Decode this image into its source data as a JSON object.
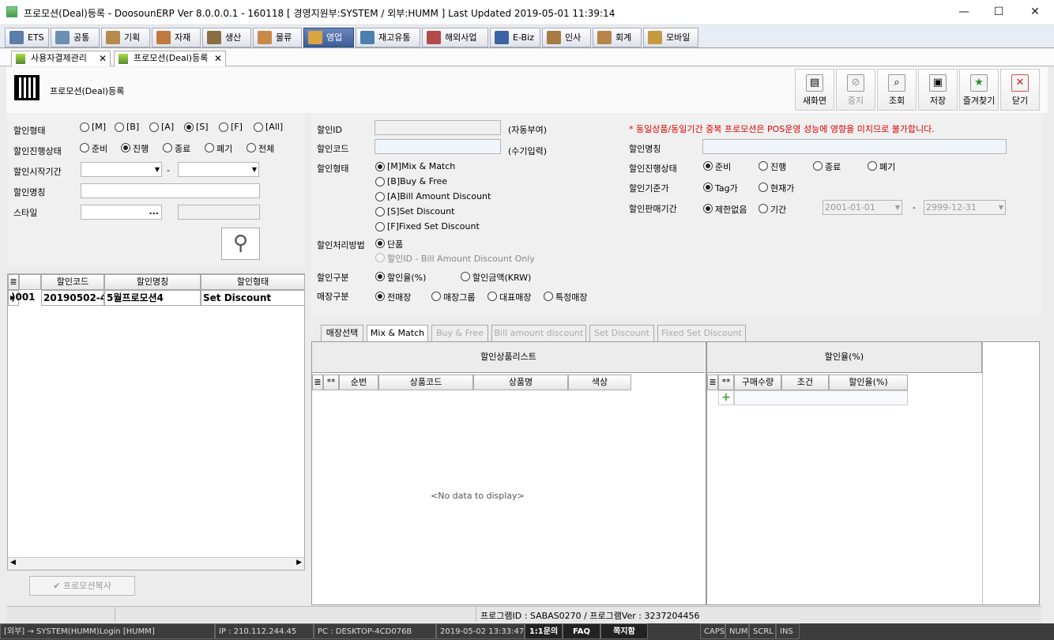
{
  "window": {
    "title": "프로모션(Deal)등록 - DoosounERP Ver 8.0.0.0.1 - 160118 [ 경영지원부:SYSTEM / 외부:HUMM ]     Last Updated 2019-05-01 11:39:14",
    "minimize": "—",
    "maximize": "☐",
    "close": "✕"
  },
  "menu": [
    {
      "label": "ETS",
      "color": "#5a7ea8"
    },
    {
      "label": "공통",
      "color": "#6d8fb5"
    },
    {
      "label": "기획",
      "color": "#b58a4c"
    },
    {
      "label": "자재",
      "color": "#c07840"
    },
    {
      "label": "생산",
      "color": "#8a6d40"
    },
    {
      "label": "물류",
      "color": "#c8894a"
    },
    {
      "label": "영업",
      "color": "#d9a441"
    },
    {
      "label": "재고유통",
      "color": "#4d7fb0"
    },
    {
      "label": "해외사업",
      "color": "#b24a4a"
    },
    {
      "label": "E-Biz",
      "color": "#3d63a5"
    },
    {
      "label": "인사",
      "color": "#a67b45"
    },
    {
      "label": "회계",
      "color": "#b5854a"
    },
    {
      "label": "모바일",
      "color": "#c49a3f"
    }
  ],
  "doc_tabs": [
    "사용자결제관리",
    "프로모션(Deal)등록"
  ],
  "page_title": "프로모션(Deal)등록",
  "toolbar": {
    "new": "새화면",
    "stop": "중지",
    "search": "조회",
    "save": "저장",
    "favorites": "즐겨찾기",
    "close": "닫기"
  },
  "left": {
    "type_label": "할인형태",
    "types": [
      "[M]",
      "[B]",
      "[A]",
      "[S]",
      "[F]",
      "[All]"
    ],
    "type_selected": "[S]",
    "status_label": "할인진행상태",
    "statuses": [
      "준비",
      "진행",
      "종료",
      "폐기",
      "전체"
    ],
    "status_selected": "진행",
    "start_label": "할인시작기간",
    "range_sep": "-",
    "name_label": "할인명칭",
    "style_label": "스타일",
    "style_btn": "...",
    "grid_headers": [
      "할인코드",
      "할인명칭",
      "할인형태"
    ],
    "grid_rows": [
      {
        "id": ")001",
        "code": "20190502-4",
        "name": "5월프로모션4",
        "type": "Set Discount"
      }
    ],
    "copy_btn": "프로모션복사"
  },
  "right": {
    "id_label": "할인ID",
    "id_hint": "(자동부여)",
    "code_label": "할인코드",
    "code_hint": "(수기입력)",
    "warning": "* 동일상품/동일기간 중복 프로모션은 POS운영 성능에 영향을 미치므로 불가합니다.",
    "name_label": "할인명칭",
    "type_label": "할인형태",
    "types": [
      "[M]Mix & Match",
      "[B]Buy & Free",
      "[A]Bill Amount Discount",
      "[S]Set Discount",
      "[F]Fixed Set Discount"
    ],
    "method_label": "할인처리방법",
    "methods": [
      "단품",
      "할인ID - Bill Amount Discount Only"
    ],
    "kind_label": "할인구분",
    "kinds": [
      "할인율(%)",
      "할인금액(KRW)"
    ],
    "store_label": "매장구분",
    "stores": [
      "전매장",
      "매장그룹",
      "대표매장",
      "특정매장"
    ],
    "status_label": "할인진행상태",
    "statuses": [
      "준비",
      "진행",
      "종료",
      "폐기"
    ],
    "basis_label": "할인기준가",
    "bases": [
      "Tag가",
      "현재가"
    ],
    "period_label": "할인판매기간",
    "periods": [
      "제한없음",
      "기간"
    ],
    "date_from": "2001-01-01",
    "date_to": "2999-12-31",
    "date_sep": "-"
  },
  "sub_tabs": [
    "매장선택",
    "Mix & Match",
    "Buy & Free",
    "Bill amount discount",
    "Set Discount",
    "Fixed Set Discount"
  ],
  "product_list": {
    "title": "할인상품리스트",
    "headers": [
      "**",
      "순번",
      "상품코드",
      "상품명",
      "색상"
    ],
    "empty": "<No data to display>"
  },
  "rate_list": {
    "title": "할인율(%)",
    "headers": [
      "**",
      "구매수량",
      "조건",
      "할인율(%)"
    ]
  },
  "program_info": "프로그램ID : SABAS0270 / 프로그램Ver : 3237204456",
  "status_bar": [
    "[외부] → SYSTEM(HUMM)Login [HUMM]",
    "IP : 210.112.244.45",
    "PC : DESKTOP-4CD076B",
    "2019-05-02 13:33:47",
    "1:1문의",
    "FAQ",
    "쪽지함",
    "CAPS",
    "NUM",
    "SCRL",
    "INS"
  ]
}
